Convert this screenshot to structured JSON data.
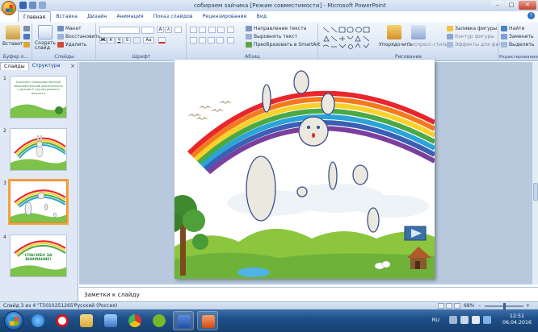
{
  "window": {
    "title": "собираем зайчика [Режим совместимости] - Microsoft PowerPoint",
    "controls": {
      "minimize": "–",
      "maximize": "□",
      "close": "✕"
    }
  },
  "ribbon": {
    "tabs": [
      "Главная",
      "Вставка",
      "Дизайн",
      "Анимация",
      "Показ слайдов",
      "Рецензирование",
      "Вид"
    ],
    "active_tab": 0,
    "help": "?",
    "clipboard": {
      "paste": "Вставить",
      "label": "Буфер о..."
    },
    "slides": {
      "new_slide": "Создать слайд",
      "layout": "Макет",
      "reset": "Восстановить",
      "delete": "Удалить",
      "label": "Слайды"
    },
    "font": {
      "label": "Шрифт",
      "grow": "A",
      "shrink": "A",
      "bold": "Ж",
      "italic": "К",
      "underline": "Ч",
      "strike": "S",
      "size_label": "Аа"
    },
    "paragraph": {
      "label": "Абзац",
      "text_direction": "Направление текста",
      "align_text": "Выровнять текст",
      "smartart": "Преобразовать в SmartArt"
    },
    "drawing": {
      "label": "Рисование",
      "arrange": "Упорядочить",
      "quick_styles": "Экспресс-стили",
      "fill": "Заливка фигуры",
      "outline": "Контур фигуры",
      "effects": "Эффекты для фигур"
    },
    "editing": {
      "label": "Редактирование",
      "find": "Найти",
      "replace": "Заменить",
      "select": "Выделить"
    }
  },
  "panel": {
    "tabs": [
      "Слайды",
      "Структура"
    ],
    "close": "×",
    "slides": [
      {
        "num": "1",
        "text": "Конспект непосредственной образовательной деятельности с детьми 2 группы раннего возраста"
      },
      {
        "num": "2",
        "text": ""
      },
      {
        "num": "3",
        "text": ""
      },
      {
        "num": "4",
        "text": "СПАСИБО ЗА ВНИМАНИЕ!"
      }
    ],
    "selected": 2
  },
  "notes": {
    "placeholder": "Заметки к слайду"
  },
  "status": {
    "slide_info": "Слайд 3 из 4",
    "theme": "\"T5010251265\"",
    "language": "Русский (Россия)",
    "zoom": "68%",
    "zoom_level": 0.68
  },
  "taskbar": {
    "lang": "RU",
    "time": "12:51",
    "date": "06.04.2016"
  },
  "colors": {
    "ribbon_blue": "#15428b",
    "selected_thumb": "#f4a340",
    "rainbow": [
      "#e8262b",
      "#f47a20",
      "#f8d12a",
      "#4aa945",
      "#2aa3d9",
      "#3b5fb5",
      "#7b3f9d"
    ]
  }
}
